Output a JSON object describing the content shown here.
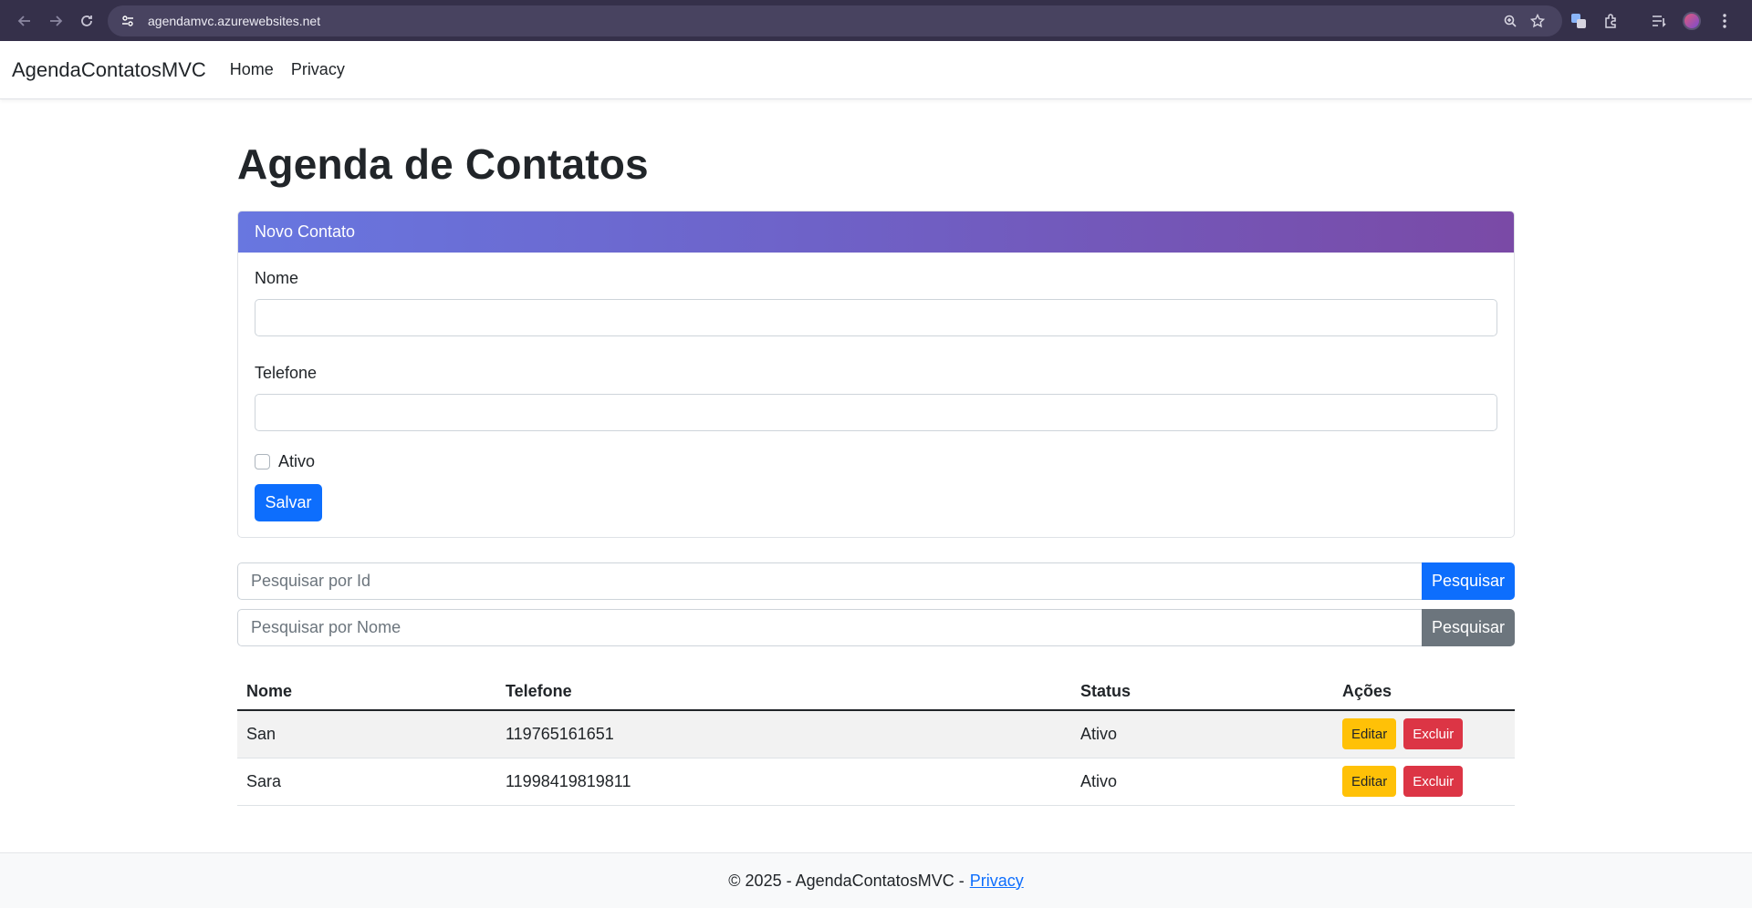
{
  "browser": {
    "url": "agendamvc.azurewebsites.net",
    "icons": [
      "back-icon",
      "forward-icon",
      "reload-icon",
      "site-settings-icon",
      "zoom-icon",
      "bookmark-star-icon",
      "translate-icon",
      "extensions-icon",
      "reading-list-icon",
      "profile-icon",
      "menu-icon"
    ]
  },
  "navbar": {
    "brand": "AgendaContatosMVC",
    "links": [
      "Home",
      "Privacy"
    ]
  },
  "page": {
    "title": "Agenda de Contatos"
  },
  "form": {
    "header": "Novo Contato",
    "name_label": "Nome",
    "name_value": "",
    "phone_label": "Telefone",
    "phone_value": "",
    "active_label": "Ativo",
    "active_checked": false,
    "save_label": "Salvar"
  },
  "search": {
    "by_id_placeholder": "Pesquisar por Id",
    "by_id_button": "Pesquisar",
    "by_name_placeholder": "Pesquisar por Nome",
    "by_name_button": "Pesquisar"
  },
  "table": {
    "headers": [
      "Nome",
      "Telefone",
      "Status",
      "Ações"
    ],
    "rows": [
      {
        "nome": "San",
        "telefone": "119765161651",
        "status": "Ativo",
        "edit": "Editar",
        "delete": "Excluir"
      },
      {
        "nome": "Sara",
        "telefone": "11998419819811",
        "status": "Ativo",
        "edit": "Editar",
        "delete": "Excluir"
      }
    ]
  },
  "footer": {
    "text": "© 2025 - AgendaContatosMVC -",
    "link": "Privacy"
  },
  "colors": {
    "primary": "#0d6efd",
    "secondary": "#6c757d",
    "warning": "#ffc107",
    "danger": "#dc3545",
    "header_gradient_start": "#6877e0",
    "header_gradient_end": "#7a4aa6"
  }
}
